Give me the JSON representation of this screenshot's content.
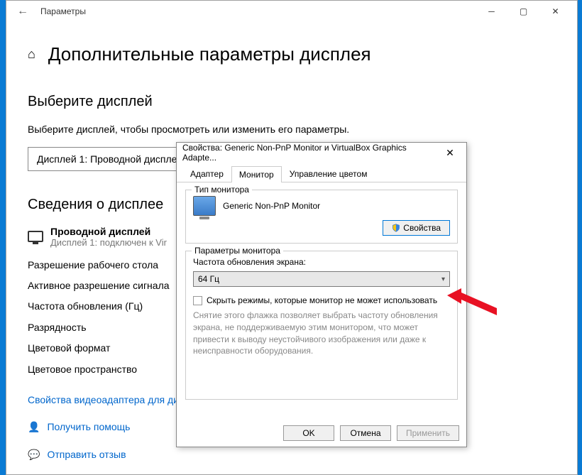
{
  "window": {
    "title": "Параметры",
    "page_title": "Дополнительные параметры дисплея"
  },
  "section_select": {
    "title": "Выберите дисплей",
    "desc": "Выберите дисплей, чтобы просмотреть или изменить его параметры.",
    "value": "Дисплей 1: Проводной диспле"
  },
  "section_info": {
    "title": "Сведения о дисплее",
    "primary": "Проводной дисплей",
    "secondary": "Дисплей 1: подключен к Vir",
    "rows": [
      "Разрешение рабочего стола",
      "Активное разрешение сигнала",
      "Частота обновления (Гц)",
      "Разрядность",
      "Цветовой формат",
      "Цветовое пространство"
    ],
    "link": "Свойства видеоадаптера для ди"
  },
  "help": {
    "get_help": "Получить помощь",
    "feedback": "Отправить отзыв"
  },
  "dialog": {
    "title": "Свойства: Generic Non-PnP Monitor и VirtualBox Graphics Adapte...",
    "tabs": [
      "Адаптер",
      "Монитор",
      "Управление цветом"
    ],
    "active_tab": 1,
    "monitor_type": {
      "legend": "Тип монитора",
      "name": "Generic Non-PnP Monitor",
      "props_btn": "Свойства"
    },
    "monitor_params": {
      "legend": "Параметры монитора",
      "refresh_label": "Частота обновления экрана:",
      "refresh_value": "64 Гц",
      "hide_modes": "Скрыть режимы, которые монитор не может использовать",
      "hint": "Снятие этого флажка позволяет выбрать частоту обновления экрана, не поддерживаемую этим монитором, что может привести к выводу неустойчивого изображения или даже к неисправности оборудования."
    },
    "buttons": {
      "ok": "OK",
      "cancel": "Отмена",
      "apply": "Применить"
    }
  }
}
